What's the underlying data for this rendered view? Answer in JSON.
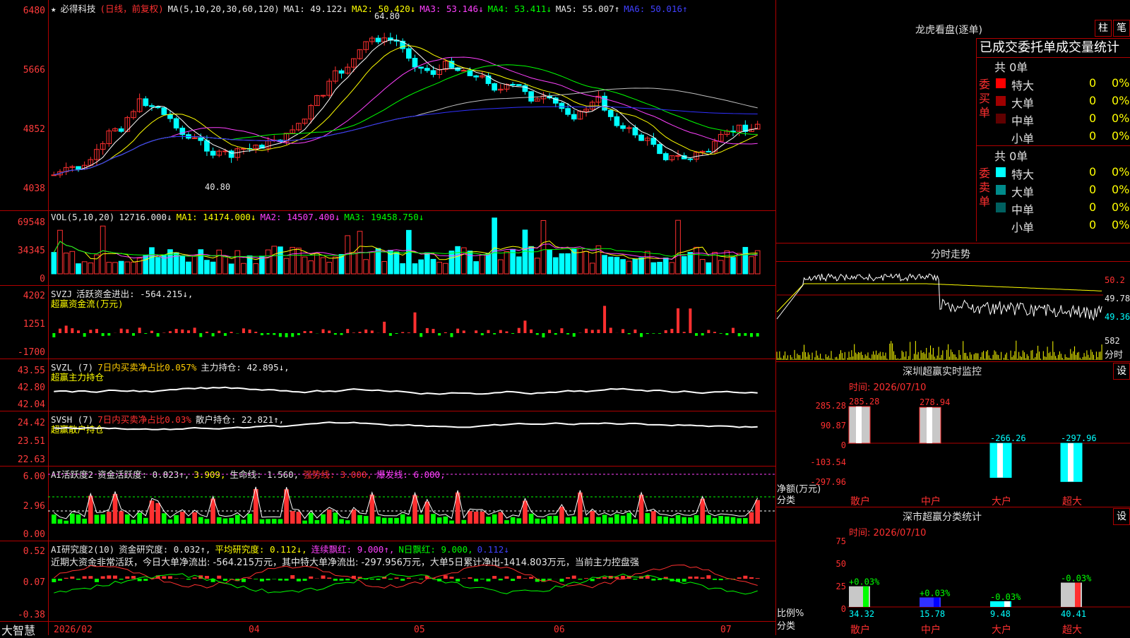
{
  "app": {
    "brand": "大智慧"
  },
  "main_chart": {
    "title_star": "★",
    "stock_name": "必得科技",
    "mode": "(日线，前复权)",
    "ma_prefix": "MA(5,10,20,30,60,120)",
    "ma1": "MA1: 49.122↓",
    "ma2": "MA2: 50.420↓",
    "ma3": "MA3: 53.146↓",
    "ma4": "MA4: 53.411↓",
    "ma5": "MA5: 55.007↑",
    "ma6": "MA6: 50.016↑",
    "y_labels": [
      "6480",
      "5666",
      "4852",
      "4038"
    ],
    "high_label": "64.80",
    "low_label": "40.80",
    "colors": {
      "up": "#ff3030",
      "down": "#00ffff",
      "ma1": "#ffffff",
      "ma2": "#ffff00",
      "ma3": "#ff40ff",
      "ma4": "#00ff00",
      "ma5": "#c0c0c0",
      "ma6": "#3030ff"
    }
  },
  "vol_panel": {
    "prefix": "VOL(5,10,20)",
    "value": "12716.000↓",
    "ma1": "MA1: 14174.000↓",
    "ma2": "MA2: 14507.400↓",
    "ma3": "MA3: 19458.750↓",
    "y_labels": [
      "69548",
      "34345",
      "0"
    ]
  },
  "svzj_panel": {
    "prefix": "SVZJ",
    "value": "活跃资金进出: -564.215↓,",
    "sub": "超赢资金流(万元)",
    "y_labels": [
      "4202",
      "1251",
      "-1700"
    ]
  },
  "svzl_panel": {
    "prefix": "SVZL (7)",
    "ratio": "7日内买卖净占比0.057%",
    "value": "主力持仓: 42.895↓,",
    "sub": "超赢主力持仓",
    "y_labels": [
      "43.55",
      "42.80",
      "42.04"
    ]
  },
  "svsh_panel": {
    "prefix": "SVSH (7)",
    "ratio": "7日内买卖净占比0.03%",
    "value": "散户持仓: 22.821↑,",
    "sub": "超赢散户持仓",
    "y_labels": [
      "24.42",
      "23.51",
      "22.63"
    ]
  },
  "ai_active_panel": {
    "prefix": "AI活跃度2",
    "value": "资金活跃度: 0.823↑,",
    "v2": "3.909,",
    "life": "生命线: 1.560,",
    "strong": "强势线: 3.000,",
    "burst": "爆发线: 6.000,",
    "y_labels": [
      "6.00",
      "2.96",
      "0.00"
    ]
  },
  "ai_research_panel": {
    "prefix": "AI研究度2(10)",
    "value": "资金研究度: 0.032↑,",
    "avg": "平均研究度: 0.112↓,",
    "cont": "连续飘红: 9.000↑,",
    "nday": "N日飘红: 9.000,",
    "last": "0.112↓",
    "note": "近期大资金非常活跃，今日大单净流出: -564.215万元，其中特大单净流出: -297.956万元，大单5日累计净出-1414.803万元，当前主力控盘强",
    "y_labels": [
      "0.52",
      "0.07",
      "-0.38"
    ]
  },
  "x_axis": {
    "labels": [
      "2026/02",
      "04",
      "05",
      "06",
      "07"
    ]
  },
  "dragon": {
    "title": "龙虎看盘(逐单)",
    "btn1": "柱",
    "btn2": "笔",
    "header": "已成交委托单成交量统计",
    "buy_side": "委买单",
    "sell_side": "委卖单",
    "buy_total": "共 0单",
    "sell_total": "共 0单",
    "buy_rows": [
      {
        "label": "特大",
        "count": "0",
        "pct": "0%",
        "color": "#ff0000"
      },
      {
        "label": "大单",
        "count": "0",
        "pct": "0%",
        "color": "#a00000"
      },
      {
        "label": "中单",
        "count": "0",
        "pct": "0%",
        "color": "#600000"
      },
      {
        "label": "小单",
        "count": "0",
        "pct": "0%",
        "color": "#000000"
      }
    ],
    "sell_rows": [
      {
        "label": "特大",
        "count": "0",
        "pct": "0%",
        "color": "#00ffff"
      },
      {
        "label": "大单",
        "count": "0",
        "pct": "0%",
        "color": "#008b8b"
      },
      {
        "label": "中单",
        "count": "0",
        "pct": "0%",
        "color": "#006060"
      },
      {
        "label": "小单",
        "count": "0",
        "pct": "0%",
        "color": "#000000"
      }
    ]
  },
  "intraday": {
    "title": "分时走势",
    "p1": "50.2",
    "p2": "49.78",
    "p3": "49.36",
    "vol": "582",
    "vol_label": "分时"
  },
  "sz_monitor": {
    "title": "深圳超赢实时监控",
    "btn": "设",
    "time": "时间: 2026/07/10",
    "y_labels": [
      "285.28",
      "90.87",
      "0",
      "-103.54",
      "-297.96"
    ],
    "unit": "净额(万元)",
    "cat_label": "分类",
    "categories": [
      "散户",
      "中户",
      "大户",
      "超大"
    ],
    "values": [
      285.28,
      278.94,
      -266.26,
      -297.96
    ],
    "value_labels": [
      "285.28",
      "278.94",
      "-266.26",
      "-297.96"
    ]
  },
  "sz_stats": {
    "title": "深市超赢分类统计",
    "btn": "设",
    "time": "时间: 2026/07/10",
    "y_labels": [
      "75",
      "50",
      "25",
      "0"
    ],
    "unit": "比例%",
    "cat_label": "分类",
    "categories": [
      "散户",
      "中户",
      "大户",
      "超大"
    ],
    "values": [
      34.32,
      15.78,
      9.48,
      40.41
    ],
    "value_labels": [
      "34.32",
      "15.78",
      "9.48",
      "40.41"
    ],
    "change_labels": [
      "+0.03%",
      "+0.03%",
      "-0.03%",
      "-0.03%"
    ]
  }
}
